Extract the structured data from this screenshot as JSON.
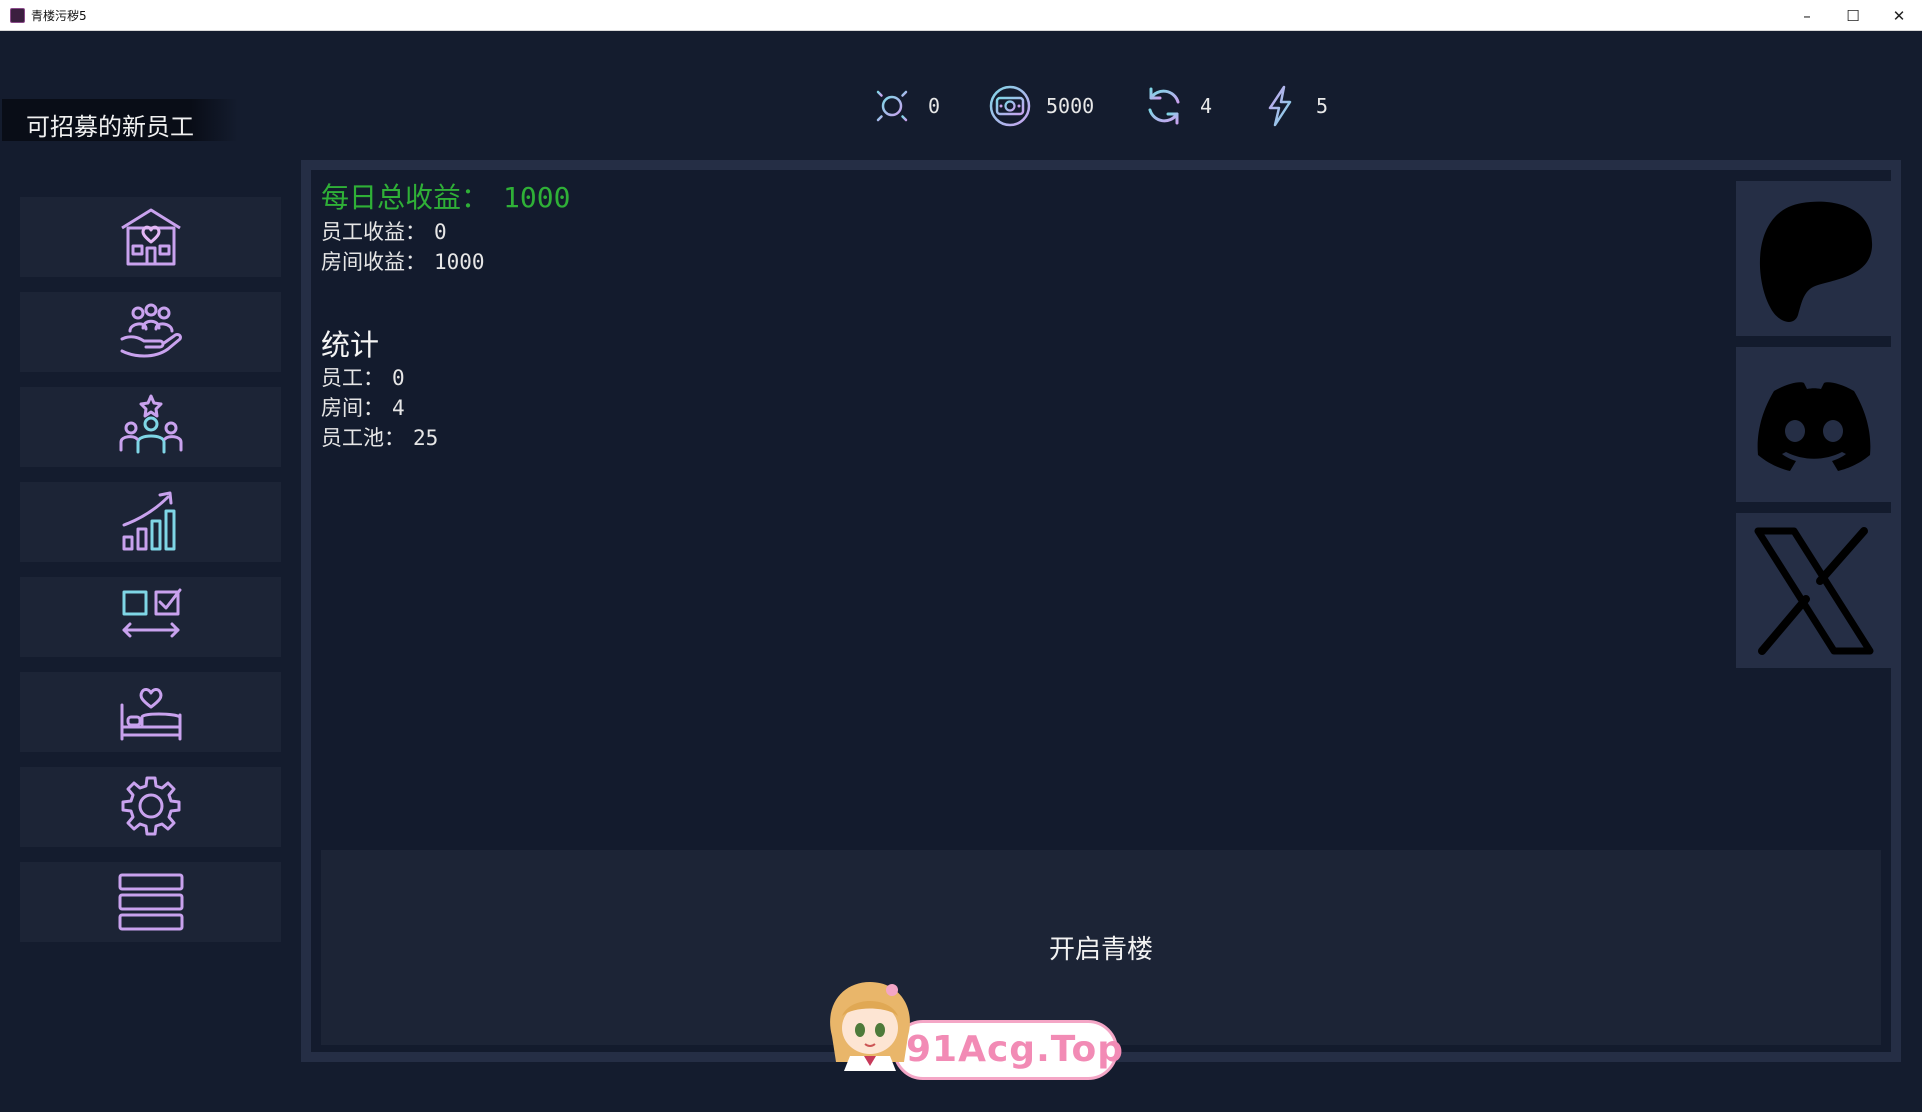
{
  "window": {
    "title": "青楼污秽5"
  },
  "page": {
    "label": "可招募的新员工"
  },
  "resources": [
    {
      "icon": "sun-icon",
      "value": "0"
    },
    {
      "icon": "money-icon",
      "value": "5000"
    },
    {
      "icon": "refresh-icon",
      "value": "4"
    },
    {
      "icon": "lightning-icon",
      "value": "5"
    }
  ],
  "sidebar": [
    {
      "icon": "brothel-building-icon"
    },
    {
      "icon": "staff-hand-icon"
    },
    {
      "icon": "star-employee-icon"
    },
    {
      "icon": "growth-chart-icon"
    },
    {
      "icon": "task-checklist-icon"
    },
    {
      "icon": "bed-heart-icon"
    },
    {
      "icon": "gear-icon"
    },
    {
      "icon": "menu-list-icon"
    }
  ],
  "income": {
    "total_label": "每日总收益：",
    "total_value": "1000",
    "staff_label": "员工收益：",
    "staff_value": "0",
    "room_label": "房间收益：",
    "room_value": "1000"
  },
  "stats": {
    "title": "统计",
    "staff_label": "员工：",
    "staff_value": "0",
    "rooms_label": "房间：",
    "rooms_value": "4",
    "pool_label": "员工池：",
    "pool_value": "25"
  },
  "social": [
    {
      "icon": "patreon-icon"
    },
    {
      "icon": "discord-icon"
    },
    {
      "icon": "x-icon"
    }
  ],
  "open_button": {
    "label": "开启青楼"
  },
  "watermark": {
    "text": "91Acg.Top"
  },
  "colors": {
    "accent_green": "#2fb037",
    "icon_purple": "#c9a2ee",
    "icon_cyan": "#7fd6e6"
  }
}
